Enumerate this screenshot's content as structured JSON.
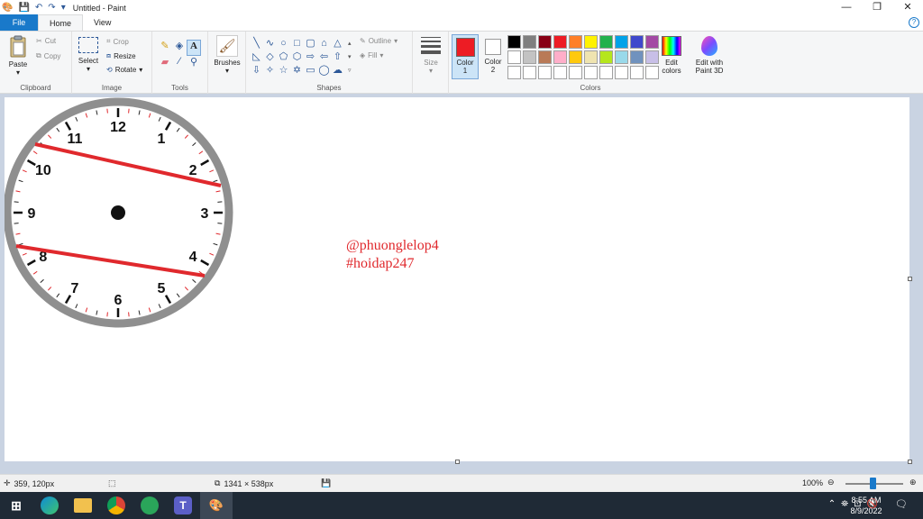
{
  "app": {
    "title": "Untitled - Paint",
    "tabs": [
      "File",
      "Home",
      "View"
    ],
    "help_icon": "help-icon"
  },
  "window": {
    "minimize": "—",
    "restore": "❐",
    "close": "✕"
  },
  "ribbon": {
    "clipboard": {
      "label": "Clipboard",
      "paste": "Paste",
      "cut": "Cut",
      "copy": "Copy"
    },
    "image": {
      "label": "Image",
      "select": "Select",
      "crop": "Crop",
      "resize": "Resize",
      "rotate": "Rotate"
    },
    "tools": {
      "label": "Tools"
    },
    "brushes": {
      "label": "Brushes"
    },
    "shapes": {
      "label": "Shapes",
      "outline": "Outline",
      "fill": "Fill"
    },
    "size": {
      "label": "Size"
    },
    "colors": {
      "label": "Colors",
      "color1": "Color\n1",
      "color2": "Color\n2",
      "color1_value": "#ed1c24",
      "color2_value": "#ffffff",
      "edit_colors": "Edit colors",
      "paint3d": "Edit with Paint 3D",
      "palette": [
        "#000000",
        "#7f7f7f",
        "#880015",
        "#ed1c24",
        "#ff7f27",
        "#fff200",
        "#22b14c",
        "#00a2e8",
        "#3f48cc",
        "#a349a4",
        "#ffffff",
        "#c3c3c3",
        "#b97a57",
        "#ffaec9",
        "#ffc90e",
        "#efe4b0",
        "#b5e61d",
        "#99d9ea",
        "#7092be",
        "#c8bfe7",
        "#ffffff",
        "#ffffff",
        "#ffffff",
        "#ffffff",
        "#ffffff",
        "#ffffff",
        "#ffffff",
        "#ffffff",
        "#ffffff",
        "#ffffff"
      ]
    }
  },
  "canvas": {
    "watermark_line1": "@phuonglelop4",
    "watermark_line2": "#hoidap247",
    "clock_numbers": [
      "12",
      "1",
      "2",
      "3",
      "4",
      "5",
      "6",
      "7",
      "8",
      "9",
      "10",
      "11"
    ]
  },
  "status": {
    "cursor_pos": "359, 120px",
    "canvas_size": "1341 × 538px",
    "zoom": "100%"
  },
  "taskbar": {
    "time": "8:55 AM",
    "date": "8/9/2022"
  }
}
